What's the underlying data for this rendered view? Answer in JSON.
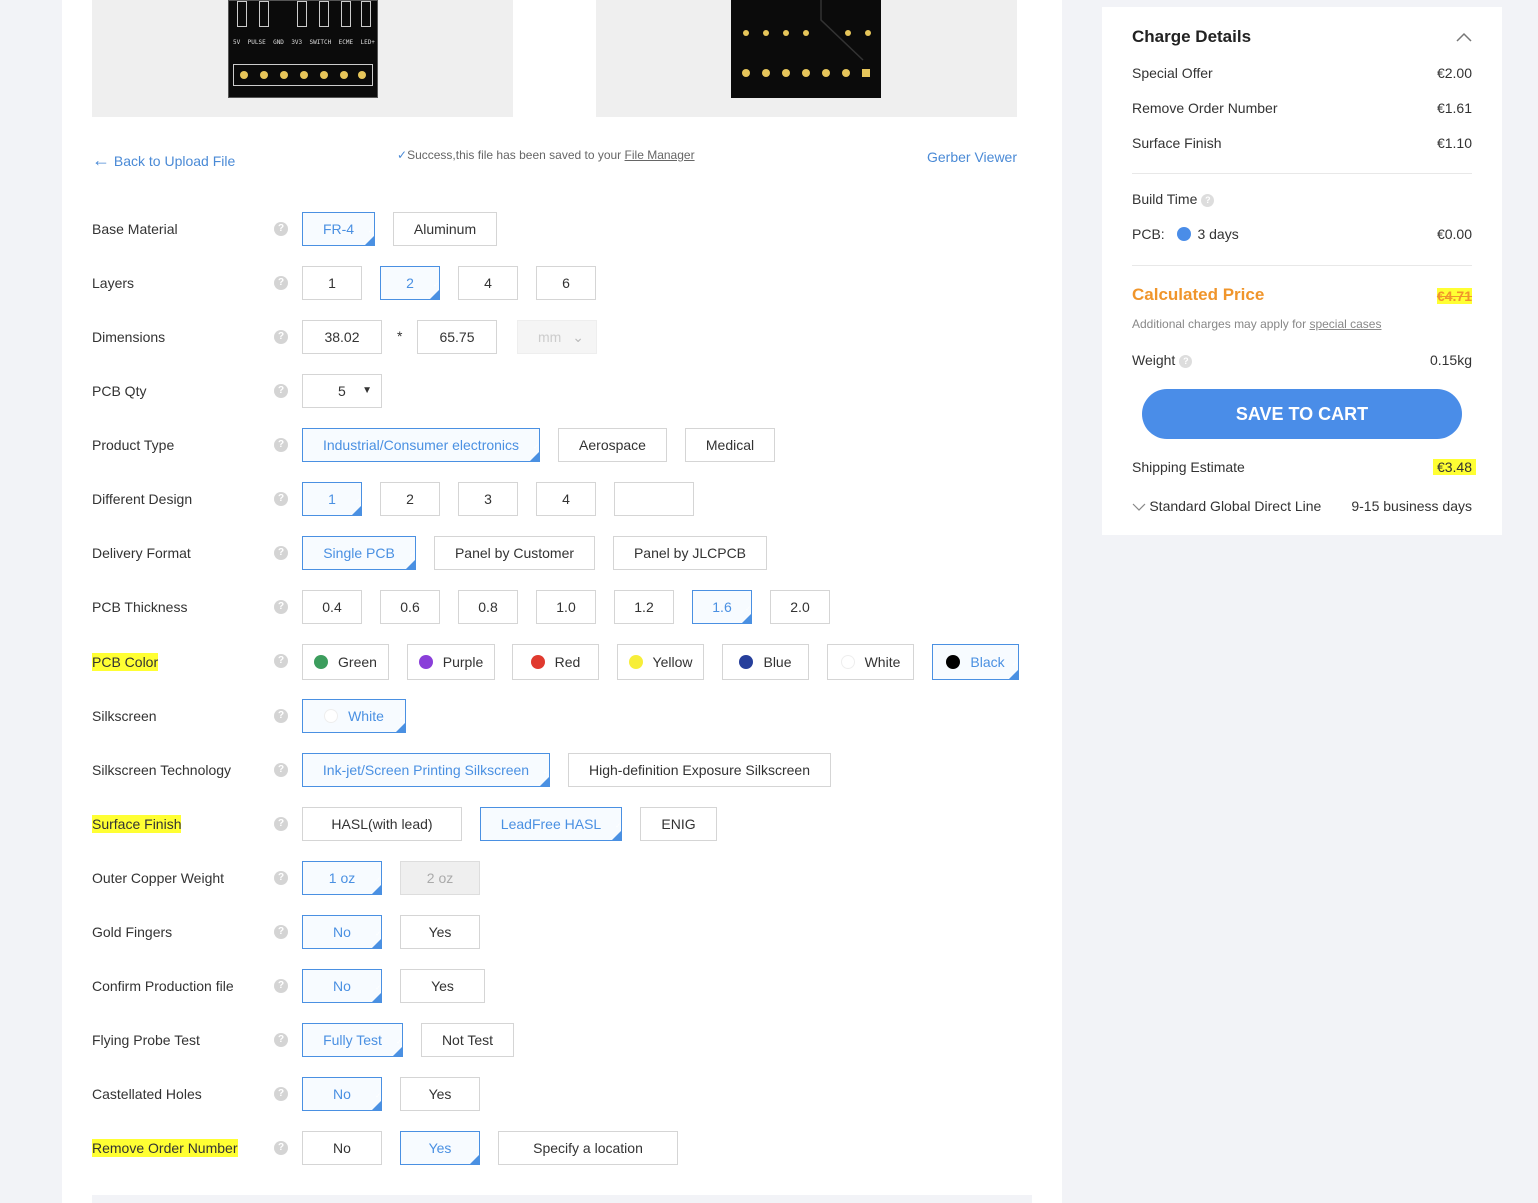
{
  "top": {
    "back_link": "Back to Upload File",
    "success_text": "Success,this file has been saved to your",
    "file_manager": "File Manager",
    "gerber_viewer": "Gerber Viewer",
    "silk_front": [
      "5V",
      "PULSE",
      "GND",
      "3V3",
      "SWITCH",
      "ECME",
      "LED+"
    ]
  },
  "options": {
    "base_material": {
      "label": "Base Material",
      "opts": [
        "FR-4",
        "Aluminum"
      ]
    },
    "layers": {
      "label": "Layers",
      "opts": [
        "1",
        "2",
        "4",
        "6"
      ]
    },
    "dimensions": {
      "label": "Dimensions",
      "width": "38.02",
      "sep": "*",
      "height": "65.75",
      "unit": "mm"
    },
    "pcb_qty": {
      "label": "PCB Qty",
      "value": "5"
    },
    "product_type": {
      "label": "Product Type",
      "opts": [
        "Industrial/Consumer electronics",
        "Aerospace",
        "Medical"
      ]
    },
    "different_design": {
      "label": "Different Design",
      "opts": [
        "1",
        "2",
        "3",
        "4"
      ]
    },
    "delivery_format": {
      "label": "Delivery Format",
      "opts": [
        "Single PCB",
        "Panel by Customer",
        "Panel by JLCPCB"
      ]
    },
    "pcb_thickness": {
      "label": "PCB Thickness",
      "opts": [
        "0.4",
        "0.6",
        "0.8",
        "1.0",
        "1.2",
        "1.6",
        "2.0"
      ]
    },
    "pcb_color": {
      "label": "PCB Color",
      "opts": [
        "Green",
        "Purple",
        "Red",
        "Yellow",
        "Blue",
        "White",
        "Black"
      ],
      "colors": [
        "#3c9d5d",
        "#8a3fd9",
        "#e03a2f",
        "#f7ee39",
        "#263f9b",
        "#ffffff",
        "#000000"
      ]
    },
    "silkscreen": {
      "label": "Silkscreen",
      "opts": [
        "White"
      ]
    },
    "silkscreen_tech": {
      "label": "Silkscreen Technology",
      "opts": [
        "Ink-jet/Screen Printing Silkscreen",
        "High-definition Exposure Silkscreen"
      ]
    },
    "surface_finish": {
      "label": "Surface Finish",
      "opts": [
        "HASL(with lead)",
        "LeadFree HASL",
        "ENIG"
      ]
    },
    "outer_copper": {
      "label": "Outer Copper Weight",
      "opts": [
        "1 oz",
        "2 oz"
      ]
    },
    "gold_fingers": {
      "label": "Gold Fingers",
      "opts": [
        "No",
        "Yes"
      ]
    },
    "confirm_file": {
      "label": "Confirm Production file",
      "opts": [
        "No",
        "Yes"
      ]
    },
    "flying_probe": {
      "label": "Flying Probe Test",
      "opts": [
        "Fully Test",
        "Not Test"
      ]
    },
    "castellated": {
      "label": "Castellated Holes",
      "opts": [
        "No",
        "Yes"
      ]
    },
    "remove_order": {
      "label": "Remove Order Number",
      "opts": [
        "No",
        "Yes",
        "Specify a location"
      ]
    }
  },
  "charge": {
    "title": "Charge Details",
    "special_offer": {
      "label": "Special Offer",
      "value": "€2.00"
    },
    "remove_order": {
      "label": "Remove Order Number",
      "value": "€1.61"
    },
    "surface_finish": {
      "label": "Surface Finish",
      "value": "€1.10"
    },
    "build_time": "Build Time",
    "pcb_label": "PCB:",
    "pcb_days": "3 days",
    "pcb_price": "€0.00",
    "calc_label": "Calculated Price",
    "calc_value": "€4.71",
    "note": "Additional charges may apply for",
    "note_link": "special cases",
    "weight_label": "Weight",
    "weight_value": "0.15kg",
    "save": "SAVE TO CART",
    "ship_label": "Shipping Estimate",
    "ship_value": "€3.48",
    "ship_method": "Standard Global Direct Line",
    "ship_days": "9-15 business days"
  },
  "colors": {
    "accent": "#4a90e2",
    "orange": "#f0952b",
    "highlight": "#ffff33"
  }
}
